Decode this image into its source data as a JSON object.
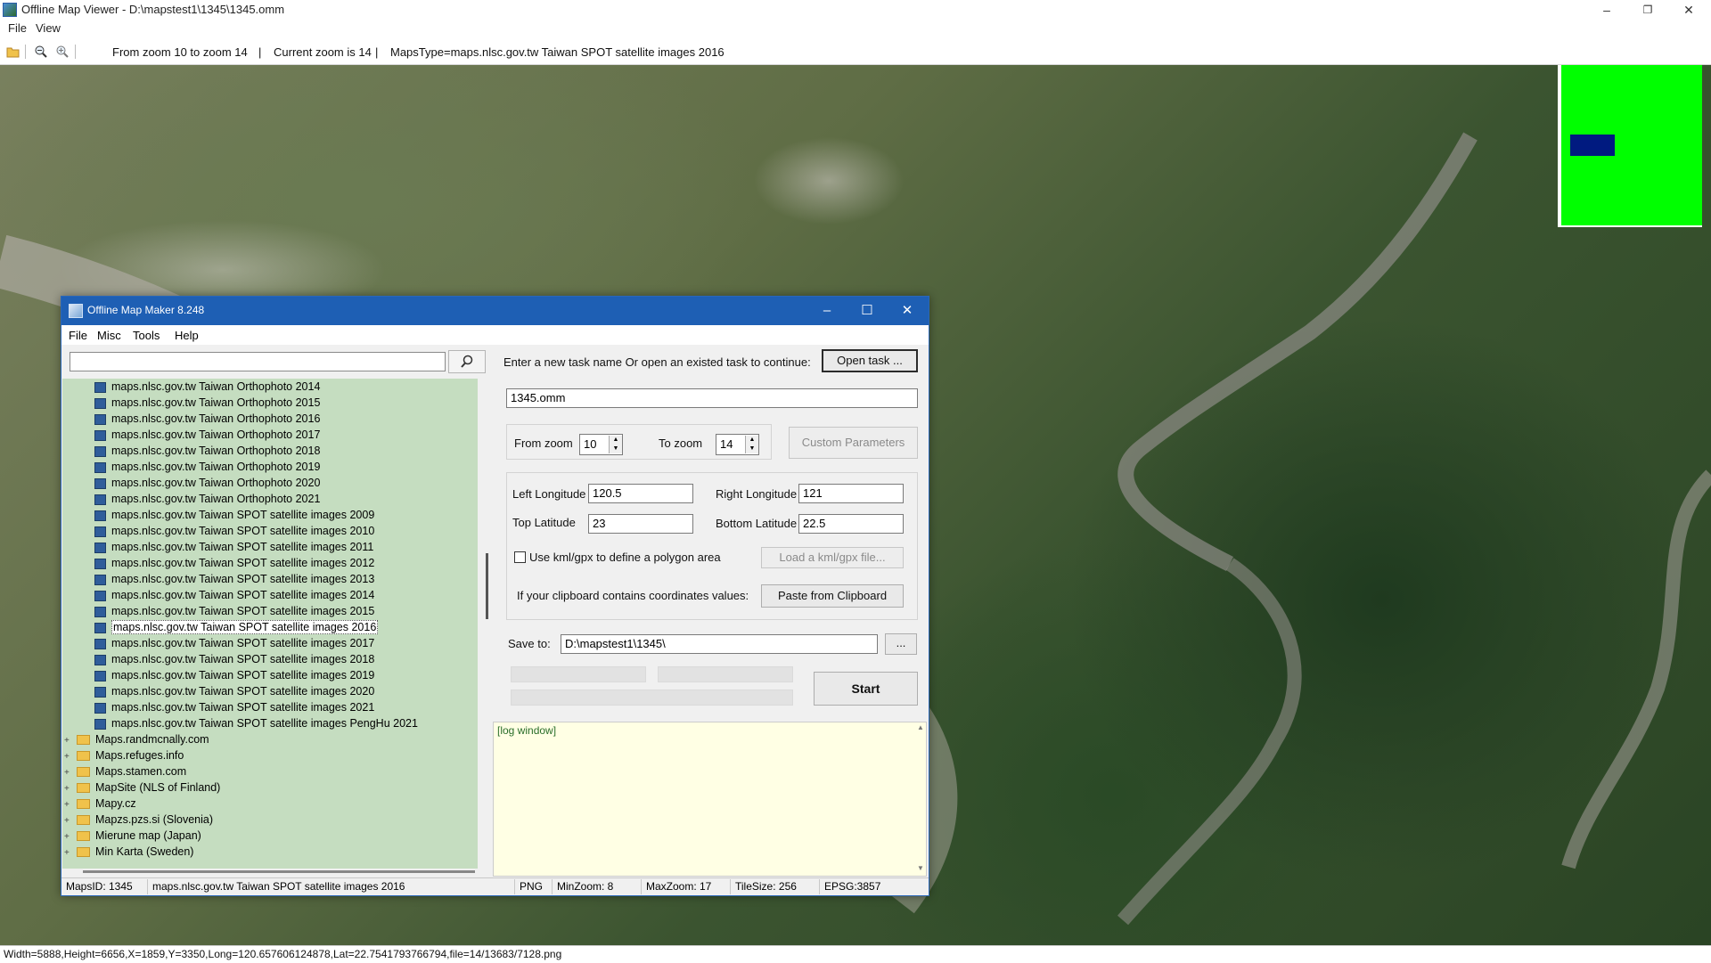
{
  "window": {
    "title": "Offline Map Viewer - D:\\mapstest1\\1345\\1345.omm",
    "controls": {
      "minimize": "–",
      "maximize": "❐",
      "close": "✕"
    }
  },
  "menu": [
    "File",
    "View"
  ],
  "toolbar": {
    "zoom_range": "From zoom 10 to zoom 14",
    "sep1": "|",
    "current_zoom": "Current zoom is 14",
    "sep2": "|",
    "maps_type": "MapsType=maps.nlsc.gov.tw Taiwan SPOT satellite images 2016"
  },
  "status": {
    "text": "Width=5888,Height=6656,X=1859,Y=3350,Long=120.657606124878,Lat=22.7541793766794,file=14/13683/7128.png"
  },
  "colors": {
    "minimap_bg": "#00ff00",
    "minimap_viewport": "#001a80",
    "dialog_title_bg": "#1e5fb4",
    "tree_bg": "#c5ddc0",
    "log_bg": "#ffffe4"
  },
  "dialog": {
    "title": "Offline Map Maker 8.248",
    "controls": {
      "minimize": "–",
      "maximize": "☐",
      "close": "✕"
    },
    "menu": [
      "File",
      "Misc",
      "Tools",
      "Help"
    ],
    "search": {
      "value": "",
      "button_icon": "search-icon"
    },
    "tree": [
      {
        "label": "maps.nlsc.gov.tw Taiwan Orthophoto 2014",
        "kind": "map"
      },
      {
        "label": "maps.nlsc.gov.tw Taiwan Orthophoto 2015",
        "kind": "map"
      },
      {
        "label": "maps.nlsc.gov.tw Taiwan Orthophoto 2016",
        "kind": "map"
      },
      {
        "label": "maps.nlsc.gov.tw Taiwan Orthophoto 2017",
        "kind": "map"
      },
      {
        "label": "maps.nlsc.gov.tw Taiwan Orthophoto 2018",
        "kind": "map"
      },
      {
        "label": "maps.nlsc.gov.tw Taiwan Orthophoto 2019",
        "kind": "map"
      },
      {
        "label": "maps.nlsc.gov.tw Taiwan Orthophoto 2020",
        "kind": "map"
      },
      {
        "label": "maps.nlsc.gov.tw Taiwan Orthophoto 2021",
        "kind": "map"
      },
      {
        "label": "maps.nlsc.gov.tw Taiwan SPOT satellite images 2009",
        "kind": "map"
      },
      {
        "label": "maps.nlsc.gov.tw Taiwan SPOT satellite images 2010",
        "kind": "map"
      },
      {
        "label": "maps.nlsc.gov.tw Taiwan SPOT satellite images 2011",
        "kind": "map"
      },
      {
        "label": "maps.nlsc.gov.tw Taiwan SPOT satellite images 2012",
        "kind": "map"
      },
      {
        "label": "maps.nlsc.gov.tw Taiwan SPOT satellite images 2013",
        "kind": "map"
      },
      {
        "label": "maps.nlsc.gov.tw Taiwan SPOT satellite images 2014",
        "kind": "map"
      },
      {
        "label": "maps.nlsc.gov.tw Taiwan SPOT satellite images 2015",
        "kind": "map"
      },
      {
        "label": "maps.nlsc.gov.tw Taiwan SPOT satellite images 2016",
        "kind": "map",
        "selected": true
      },
      {
        "label": "maps.nlsc.gov.tw Taiwan SPOT satellite images 2017",
        "kind": "map"
      },
      {
        "label": "maps.nlsc.gov.tw Taiwan SPOT satellite images 2018",
        "kind": "map"
      },
      {
        "label": "maps.nlsc.gov.tw Taiwan SPOT satellite images 2019",
        "kind": "map"
      },
      {
        "label": "maps.nlsc.gov.tw Taiwan SPOT satellite images 2020",
        "kind": "map"
      },
      {
        "label": "maps.nlsc.gov.tw Taiwan SPOT satellite images 2021",
        "kind": "map"
      },
      {
        "label": "maps.nlsc.gov.tw Taiwan SPOT satellite images PengHu 2021",
        "kind": "map"
      },
      {
        "label": "Maps.randmcnally.com",
        "kind": "folder"
      },
      {
        "label": "Maps.refuges.info",
        "kind": "folder"
      },
      {
        "label": "Maps.stamen.com",
        "kind": "folder"
      },
      {
        "label": "MapSite (NLS of Finland)",
        "kind": "folder"
      },
      {
        "label": "Mapy.cz",
        "kind": "folder"
      },
      {
        "label": "Mapzs.pzs.si (Slovenia)",
        "kind": "folder"
      },
      {
        "label": "Mierune map (Japan)",
        "kind": "folder"
      },
      {
        "label": "Min Karta (Sweden)",
        "kind": "folder"
      }
    ],
    "task_prompt": "Enter a new task name Or open an existed task to continue:",
    "open_task": "Open task ...",
    "task_name": "1345.omm",
    "from_zoom_label": "From zoom",
    "from_zoom": "10",
    "to_zoom_label": "To zoom",
    "to_zoom": "14",
    "custom_params": "Custom Parameters",
    "left_lon_label": "Left Longitude",
    "left_lon": "120.5",
    "right_lon_label": "Right Longitude",
    "right_lon": "121",
    "top_lat_label": "Top Latitude",
    "top_lat": "23",
    "bottom_lat_label": "Bottom Latitude",
    "bottom_lat": "22.5",
    "kml_checkbox": "Use kml/gpx to define a polygon area",
    "load_kml": "Load a kml/gpx file...",
    "clipboard_label": "If your clipboard contains coordinates values:",
    "paste_clipboard": "Paste from Clipboard",
    "save_to_label": "Save to:",
    "save_to": "D:\\mapstest1\\1345\\",
    "browse": "...",
    "start": "Start",
    "log_title": "[log window]",
    "status": {
      "maps_id": "MapsID: 1345",
      "maps_name": "maps.nlsc.gov.tw Taiwan SPOT satellite images 2016",
      "format": "PNG",
      "min_zoom": "MinZoom: 8",
      "max_zoom": "MaxZoom: 17",
      "tile_size": "TileSize: 256",
      "epsg": "EPSG:3857"
    }
  }
}
